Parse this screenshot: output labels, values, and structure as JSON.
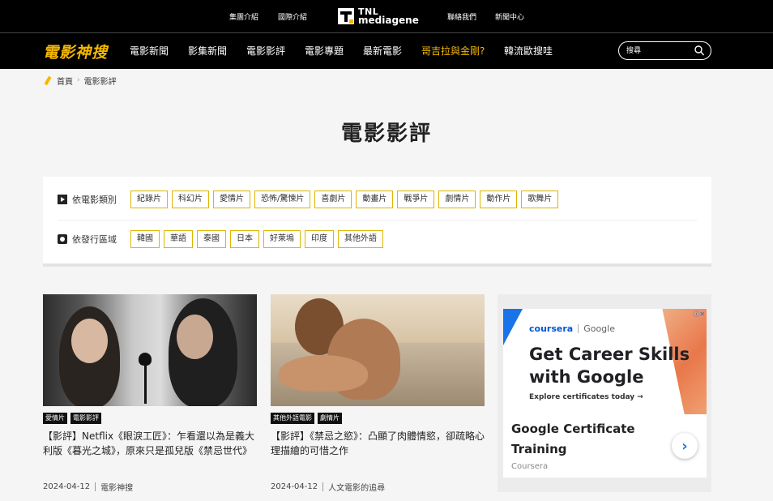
{
  "topbar": {
    "links": [
      "集團介紹",
      "國際介紹",
      "聯絡我們",
      "新聞中心"
    ],
    "brand_line1": "TNL",
    "brand_line2": "mediagene"
  },
  "navbar": {
    "logo": "電影神搜",
    "items": [
      "電影新聞",
      "影集新聞",
      "電影影評",
      "電影專題",
      "最新電影",
      "哥吉拉與金剛?",
      "韓流歐搜哇"
    ],
    "highlight_color": "#f5b800",
    "search_placeholder": "搜尋"
  },
  "breadcrumb": {
    "home": "首頁",
    "sep": "›",
    "current": "電影影評"
  },
  "page_title": "電影影評",
  "filters": {
    "genre_label": "依電影類別",
    "genres": [
      "紀錄片",
      "科幻片",
      "愛情片",
      "恐怖/驚悚片",
      "喜劇片",
      "動畫片",
      "戰爭片",
      "劇情片",
      "動作片",
      "歌舞片"
    ],
    "region_label": "依發行區域",
    "regions": [
      "韓國",
      "華語",
      "泰國",
      "日本",
      "好萊塢",
      "印度",
      "其他外語"
    ]
  },
  "articles": [
    {
      "tags": [
        "愛情片",
        "電影影評"
      ],
      "headline": "【影評】Netflix《眼淚工匠》：乍看還以為是義大利版《暮光之城》，原來只是孤兒版《禁忌世代》",
      "date": "2024-04-12",
      "author": "電影神搜"
    },
    {
      "tags": [
        "其他外語電影",
        "劇情片"
      ],
      "headline": "【影評】《禁忌之慾》：凸顯了肉體情慾，卻疏略心理描繪的可惜之作",
      "date": "2024-04-12",
      "author": "人文電影的追尋"
    }
  ],
  "ad": {
    "adchoices": "ⓘ✕",
    "brand1": "coursera",
    "brand2": "Google",
    "headline": "Get Career Skills with Google",
    "sub": "Explore certificates today →",
    "title": "Google Certificate Training",
    "source": "Coursera",
    "arrow": "›"
  }
}
